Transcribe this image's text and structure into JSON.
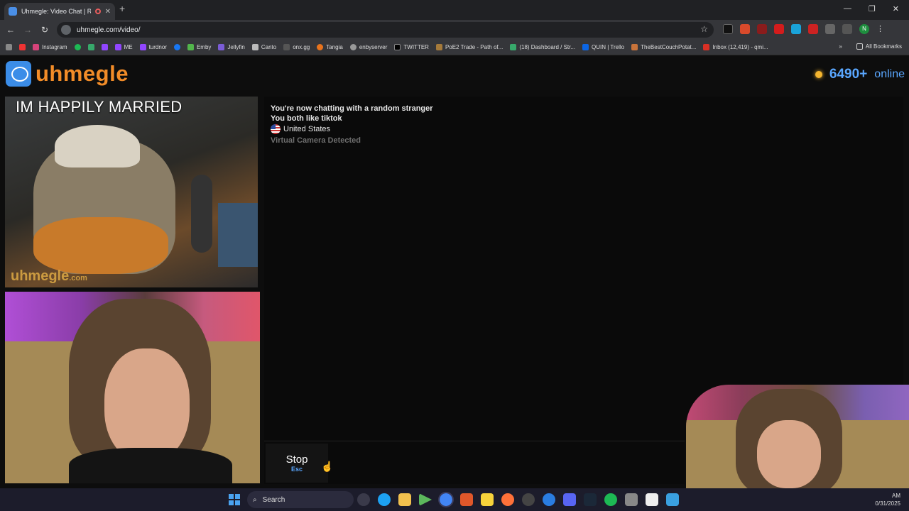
{
  "browser": {
    "tab_title": "Uhmegle: Video Chat | Ran",
    "url": "uhmegle.com/video/",
    "bookmarks": [
      "Instagram",
      "ME",
      "turdnor",
      "Emby",
      "Jellyfin",
      "Canto",
      "onx.gg",
      "Tangia",
      "enbyserver",
      "TWITTER",
      "PoE2 Trade - Path of...",
      "(18) Dashboard / Str...",
      "QUIN | Trello",
      "TheBestCouchPotat...",
      "Inbox (12,419) - qmi..."
    ],
    "all_bookmarks": "All Bookmarks"
  },
  "site": {
    "logo_text": "uhmegle",
    "online_count": "6490+",
    "online_label": "online"
  },
  "stranger_video": {
    "overlay_text": "IM HAPPILY MARRIED",
    "watermark": "uhmegle",
    "watermark_suffix": ".com"
  },
  "chat": {
    "line1": "You're now chatting with a random stranger",
    "line2": "You both like tiktok",
    "country": "United States",
    "warning": "Virtual Camera Detected"
  },
  "controls": {
    "stop_label": "Stop",
    "stop_key": "Esc"
  },
  "taskbar": {
    "search_label": "Search",
    "time_fragment": "AM",
    "date_fragment": "0/31/2025"
  },
  "colors": {
    "accent_blue": "#5aa7ff",
    "logo_orange": "#f28c28",
    "online_dot": "#f5b52f"
  }
}
